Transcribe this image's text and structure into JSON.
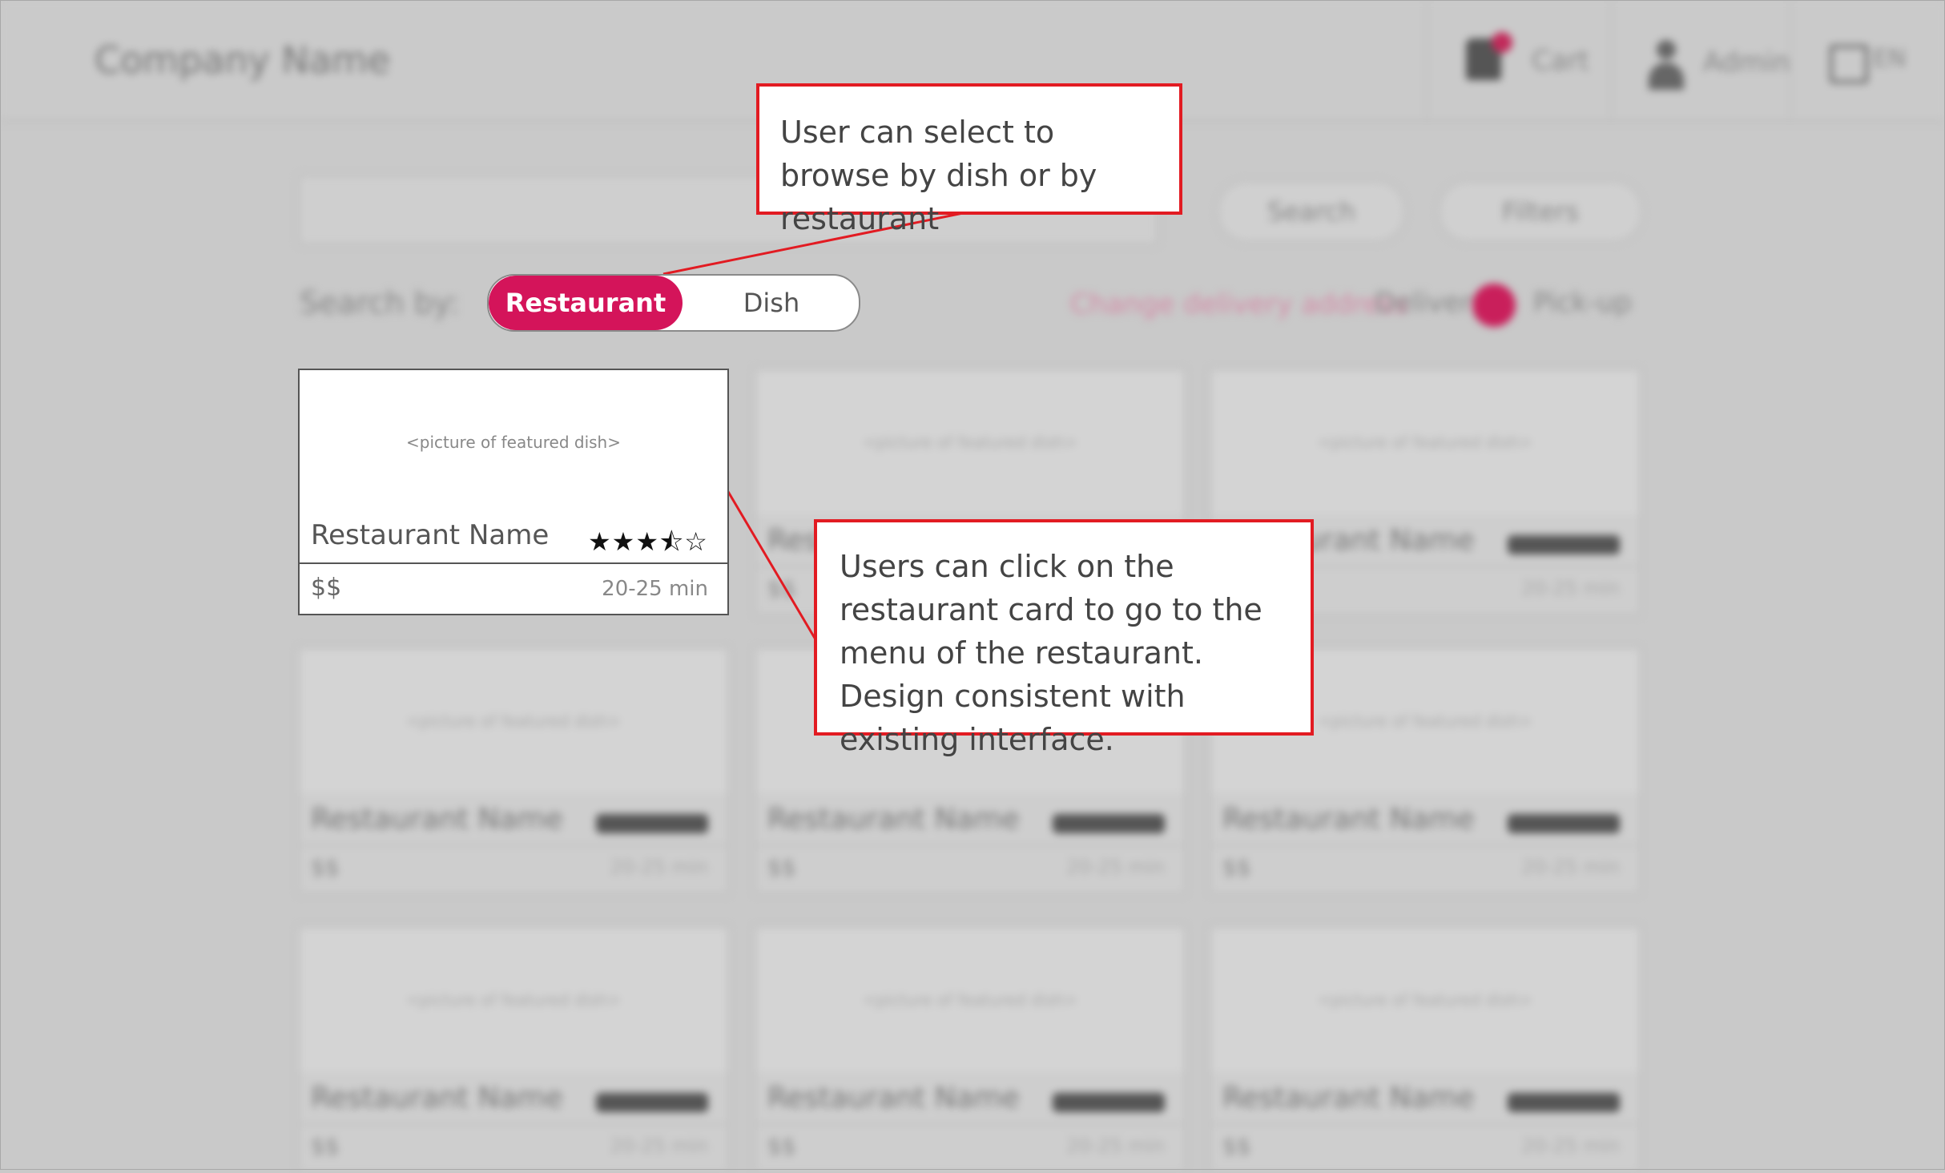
{
  "header": {
    "company_name": "Company Name",
    "cart_label": "Cart",
    "account_label": "Admin",
    "language_label": "EN"
  },
  "search": {
    "placeholder": "",
    "search_button": "Search",
    "filter_button": "Filters"
  },
  "search_by": {
    "label": "Search by:",
    "options": [
      "Restaurant",
      "Dish"
    ],
    "selected": "Restaurant"
  },
  "delivery": {
    "change_address": "Change delivery address",
    "delivery_label": "Delivery",
    "pickup_label": "Pick-up"
  },
  "featured_card": {
    "picture_placeholder": "<picture of featured dish>",
    "name": "Restaurant Name",
    "rating": 3.5,
    "rating_max": 5,
    "stars": "★★★⯪☆",
    "price": "$$",
    "time": "20-25 min"
  },
  "ghost_cards": {
    "picture_placeholder": "<picture of featured dish>",
    "name": "Restaurant Name",
    "price": "$$",
    "time": "20-25 min"
  },
  "callouts": {
    "toggle_note": "User can select to browse by dish or by restaurant",
    "card_note": "Users can click on the restaurant card to go to the menu of the restaurant. Design consistent with existing interface."
  },
  "colors": {
    "accent": "#d4145a",
    "callout_border": "#e21b22",
    "overlay": "#c9c9c9"
  }
}
